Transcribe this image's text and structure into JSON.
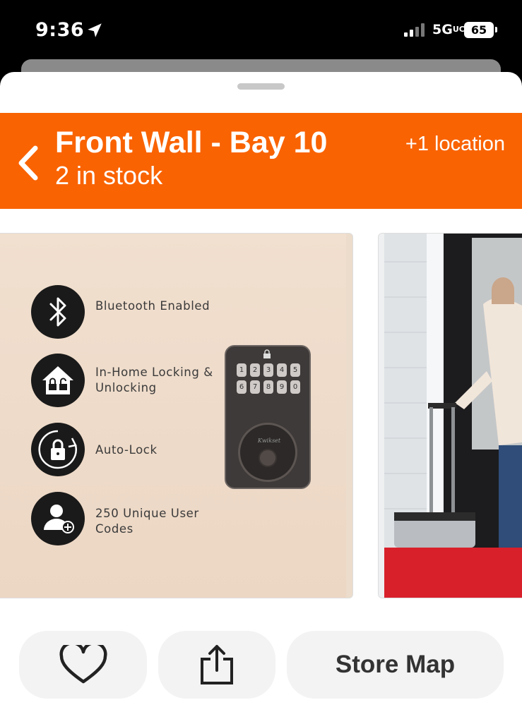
{
  "status_bar": {
    "time": "9:36",
    "network": "5G",
    "network_suffix": "UC",
    "battery": "65"
  },
  "location_banner": {
    "title": "Front Wall - Bay 10",
    "stock": "2 in stock",
    "extra_locations": "+1 location",
    "color": "#f96302"
  },
  "product_images": {
    "slide1": {
      "features": [
        {
          "icon": "bluetooth-icon",
          "label": "Bluetooth Enabled"
        },
        {
          "icon": "home-lock-icon",
          "label": "In-Home Locking & Unlocking"
        },
        {
          "icon": "auto-lock-icon",
          "label": "Auto-Lock"
        },
        {
          "icon": "user-add-icon",
          "label": "250 Unique User Codes"
        }
      ],
      "lock_brand": "Kwikset",
      "keypad": [
        "1",
        "2",
        "3",
        "4",
        "5",
        "6",
        "7",
        "8",
        "9",
        "0"
      ]
    }
  },
  "actions": {
    "favorite_icon": "heart-icon",
    "share_icon": "share-icon",
    "store_map_label": "Store Map"
  }
}
